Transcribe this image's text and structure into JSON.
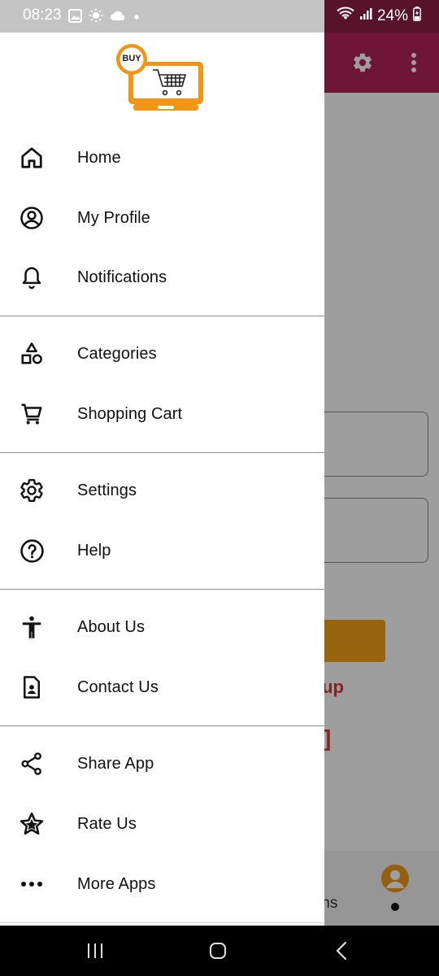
{
  "status_bar": {
    "time": "08:23",
    "battery": "24%",
    "icons": [
      "image-icon",
      "brightness-icon",
      "cloud-icon",
      "dot-icon",
      "wifi-icon",
      "signal-icon",
      "battery-icon"
    ]
  },
  "background_screen": {
    "link_text": "up",
    "bracket_text": "]",
    "bottom_nav_label": "ms",
    "accent": "#b3245a",
    "button_color": "#f5a21b"
  },
  "drawer": {
    "logo_text": "BUY",
    "items": [
      {
        "label": "Home",
        "icon": "home-icon"
      },
      {
        "label": "My Profile",
        "icon": "profile-icon"
      },
      {
        "label": "Notifications",
        "icon": "bell-icon"
      },
      {
        "label": "Categories",
        "icon": "categories-icon"
      },
      {
        "label": "Shopping Cart",
        "icon": "cart-icon"
      },
      {
        "label": "Settings",
        "icon": "gear-icon"
      },
      {
        "label": "Help",
        "icon": "help-icon"
      },
      {
        "label": "About Us",
        "icon": "accessibility-icon"
      },
      {
        "label": "Contact Us",
        "icon": "contact-icon"
      },
      {
        "label": "Share App",
        "icon": "share-icon"
      },
      {
        "label": "Rate Us",
        "icon": "star-icon"
      },
      {
        "label": "More Apps",
        "icon": "more-icon"
      }
    ]
  },
  "nav_bar": {
    "buttons": [
      "recents-icon",
      "home-circle-icon",
      "back-icon"
    ]
  }
}
